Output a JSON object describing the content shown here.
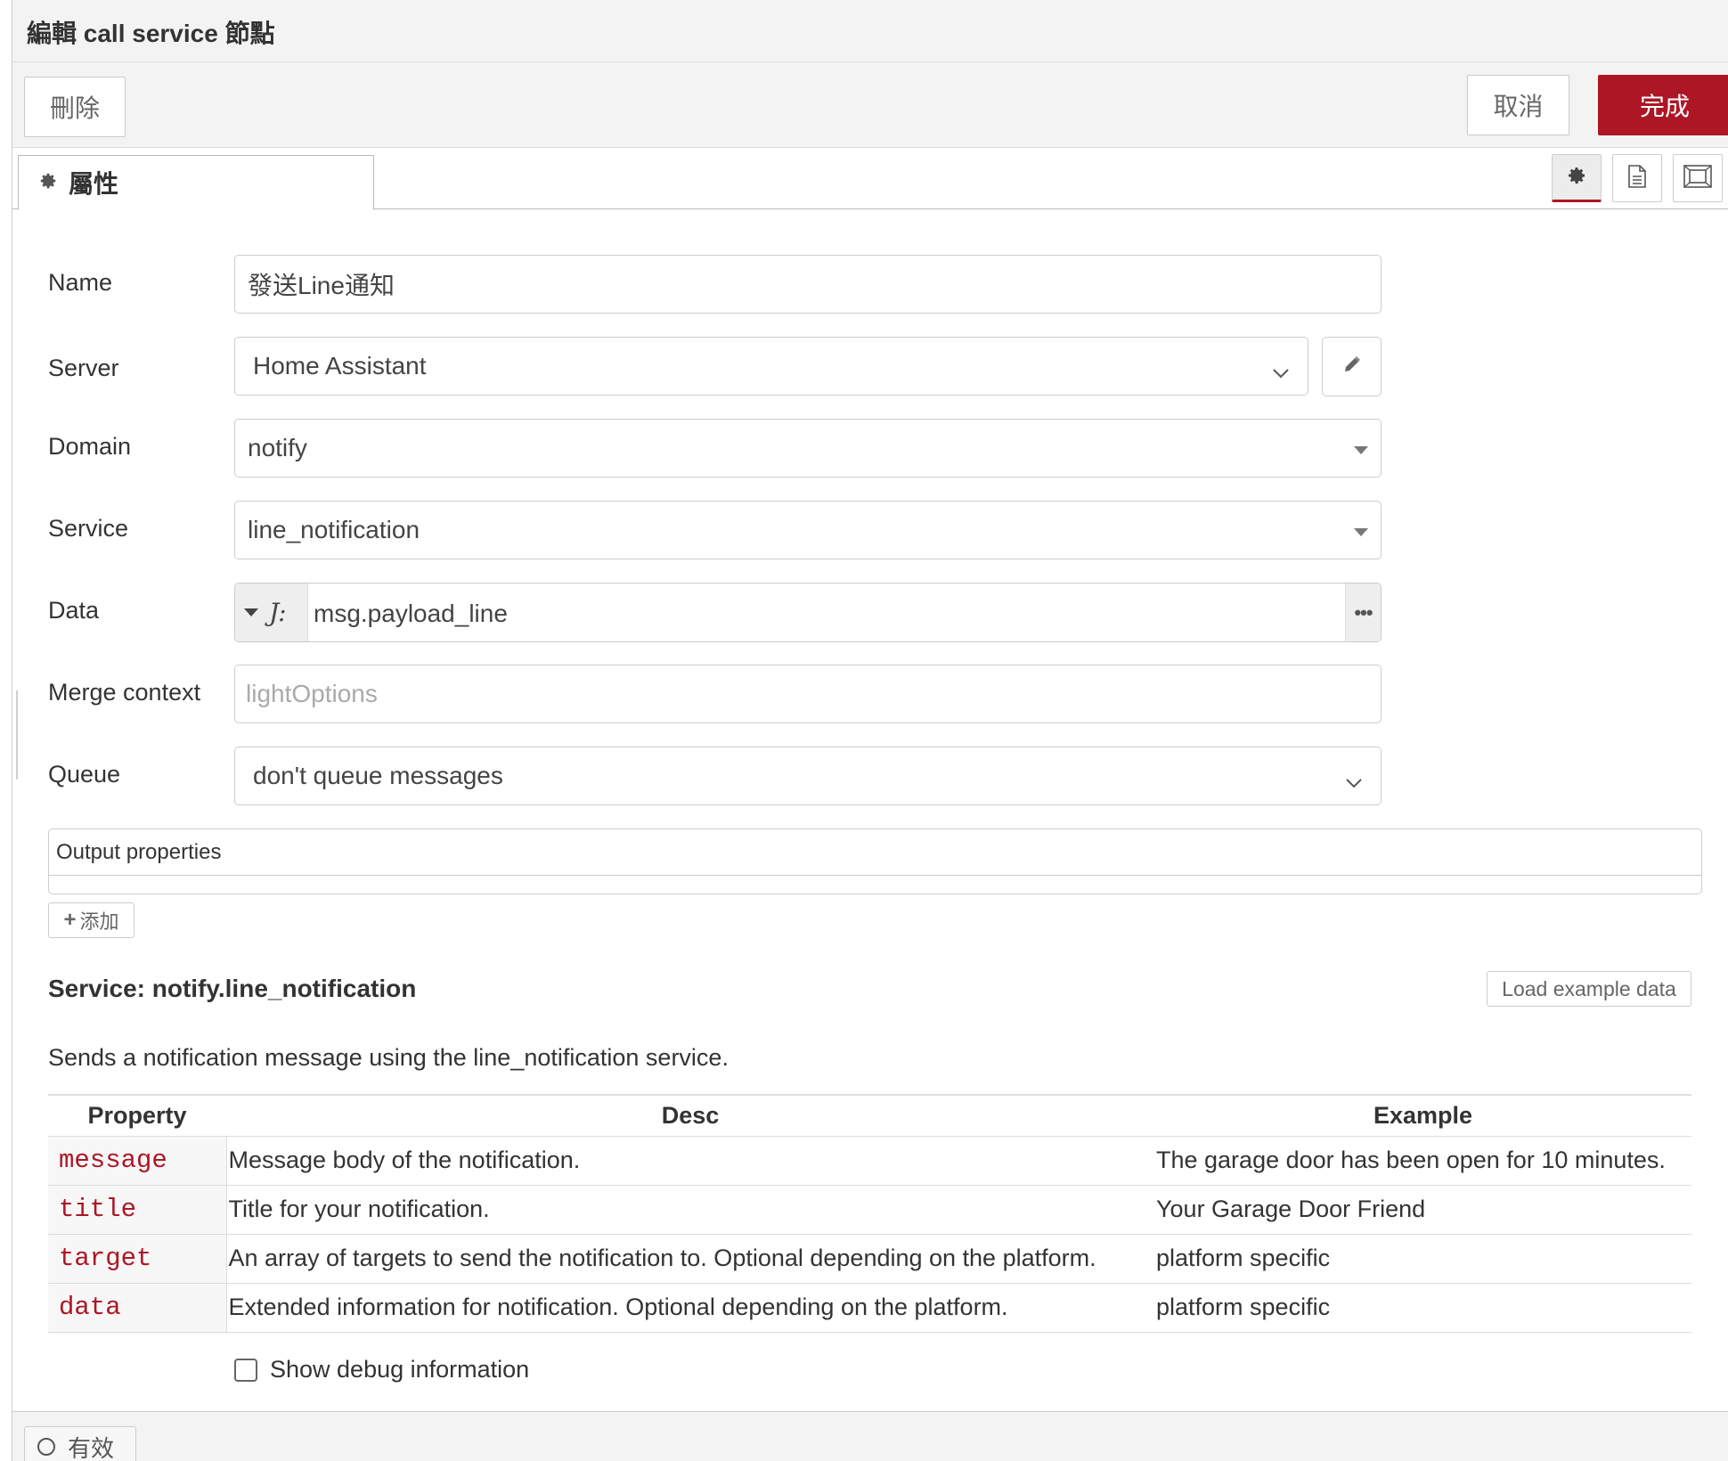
{
  "header": {
    "title": "編輯 call service 節點"
  },
  "toolbar": {
    "delete_label": "刪除",
    "cancel_label": "取消",
    "done_label": "完成"
  },
  "tabs": {
    "properties_label": "屬性"
  },
  "form": {
    "name": {
      "label": "Name",
      "value": "發送Line通知"
    },
    "server": {
      "label": "Server",
      "value": "Home Assistant"
    },
    "domain": {
      "label": "Domain",
      "value": "notify"
    },
    "service": {
      "label": "Service",
      "value": "line_notification"
    },
    "data": {
      "label": "Data",
      "type_glyph": "J:",
      "value": "msg.payload_line",
      "more": "•••"
    },
    "merge_context": {
      "label": "Merge context",
      "placeholder": "lightOptions"
    },
    "queue": {
      "label": "Queue",
      "value": "don't queue messages"
    }
  },
  "output_properties": {
    "label": "Output properties",
    "add_label": "添加"
  },
  "service_info": {
    "title": "Service: notify.line_notification",
    "load_example_label": "Load example data",
    "description": "Sends a notification message using the line_notification service.",
    "columns": [
      "Property",
      "Desc",
      "Example"
    ],
    "rows": [
      {
        "property": "message",
        "desc": "Message body of the notification.",
        "example": "The garage door has been open for 10 minutes."
      },
      {
        "property": "title",
        "desc": "Title for your notification.",
        "example": "Your Garage Door Friend"
      },
      {
        "property": "target",
        "desc": "An array of targets to send the notification to. Optional depending on the platform.",
        "example": "platform specific"
      },
      {
        "property": "data",
        "desc": "Extended information for notification. Optional depending on the platform.",
        "example": "platform specific"
      }
    ]
  },
  "debug": {
    "label": "Show debug information",
    "checked": false
  },
  "footer": {
    "enabled_label": "有效"
  },
  "colors": {
    "accent": "#ad1625",
    "property_code": "#ad1625"
  }
}
